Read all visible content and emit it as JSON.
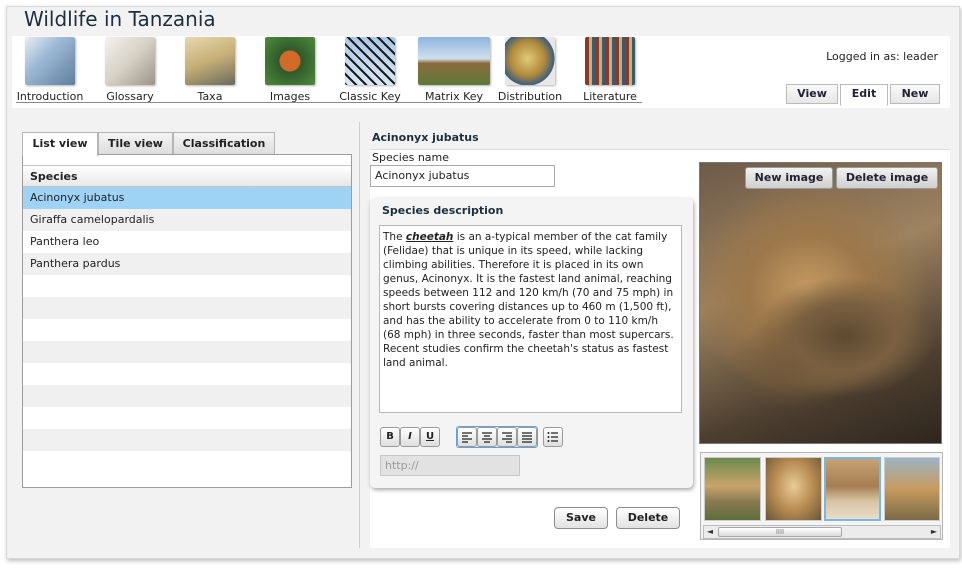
{
  "app": {
    "title": "Wildlife in Tanzania",
    "logged_in": "Logged in as: leader"
  },
  "nav": [
    {
      "label": "Introduction",
      "icon": "scientists-icon",
      "color": "#7fa8c8"
    },
    {
      "label": "Glossary",
      "icon": "reading-hand-icon",
      "color": "#c8c4bc"
    },
    {
      "label": "Taxa",
      "icon": "file-folders-icon",
      "color": "#c4b488"
    },
    {
      "label": "Images",
      "icon": "butterfly-icon",
      "color": "#4f7a3a"
    },
    {
      "label": "Classic Key",
      "icon": "tree-branches-icon",
      "color": "#8bb0d0"
    },
    {
      "label": "Matrix Key",
      "icon": "key-icon",
      "color": "#b48b58"
    },
    {
      "label": "Distribution",
      "icon": "globe-icon",
      "color": "#b89a4c"
    },
    {
      "label": "Literature",
      "icon": "bookshelf-icon",
      "color": "#b04a3a"
    }
  ],
  "modes": {
    "view": "View",
    "edit": "Edit",
    "new": "New"
  },
  "left": {
    "tabs": {
      "list": "List view",
      "tile": "Tile view",
      "classification": "Classification"
    },
    "list_header": "Species",
    "rows": [
      "Acinonyx jubatus",
      "Giraffa camelopardalis",
      "Panthera leo",
      "Panthera pardus"
    ]
  },
  "detail": {
    "title": "Acinonyx jubatus",
    "species_name_label": "Species name",
    "species_name_value": "Acinonyx jubatus",
    "description_title": "Species description",
    "description": {
      "prefix": "The ",
      "emph": "cheetah",
      "body": " is an a-typical member of the cat family (Felidae) that is unique in its speed, while lacking climbing abilities. Therefore it is placed in its own genus, Acinonyx. It is the fastest land animal, reaching speeds between 112 and 120 km/h (70 and 75 mph) in short bursts covering distances up to 460 m (1,500 ft), and has the ability to accelerate from 0 to 110 km/h (68 mph) in three seconds, faster than most supercars. Recent studies confirm the cheetah's status as fastest land animal."
    },
    "format_buttons": {
      "bold": "B",
      "italic": "I",
      "underline": "U"
    },
    "url_placeholder": "http://",
    "save": "Save",
    "delete": "Delete",
    "image_new": "New image",
    "image_delete": "Delete image",
    "scroll_grip": "IIII"
  }
}
